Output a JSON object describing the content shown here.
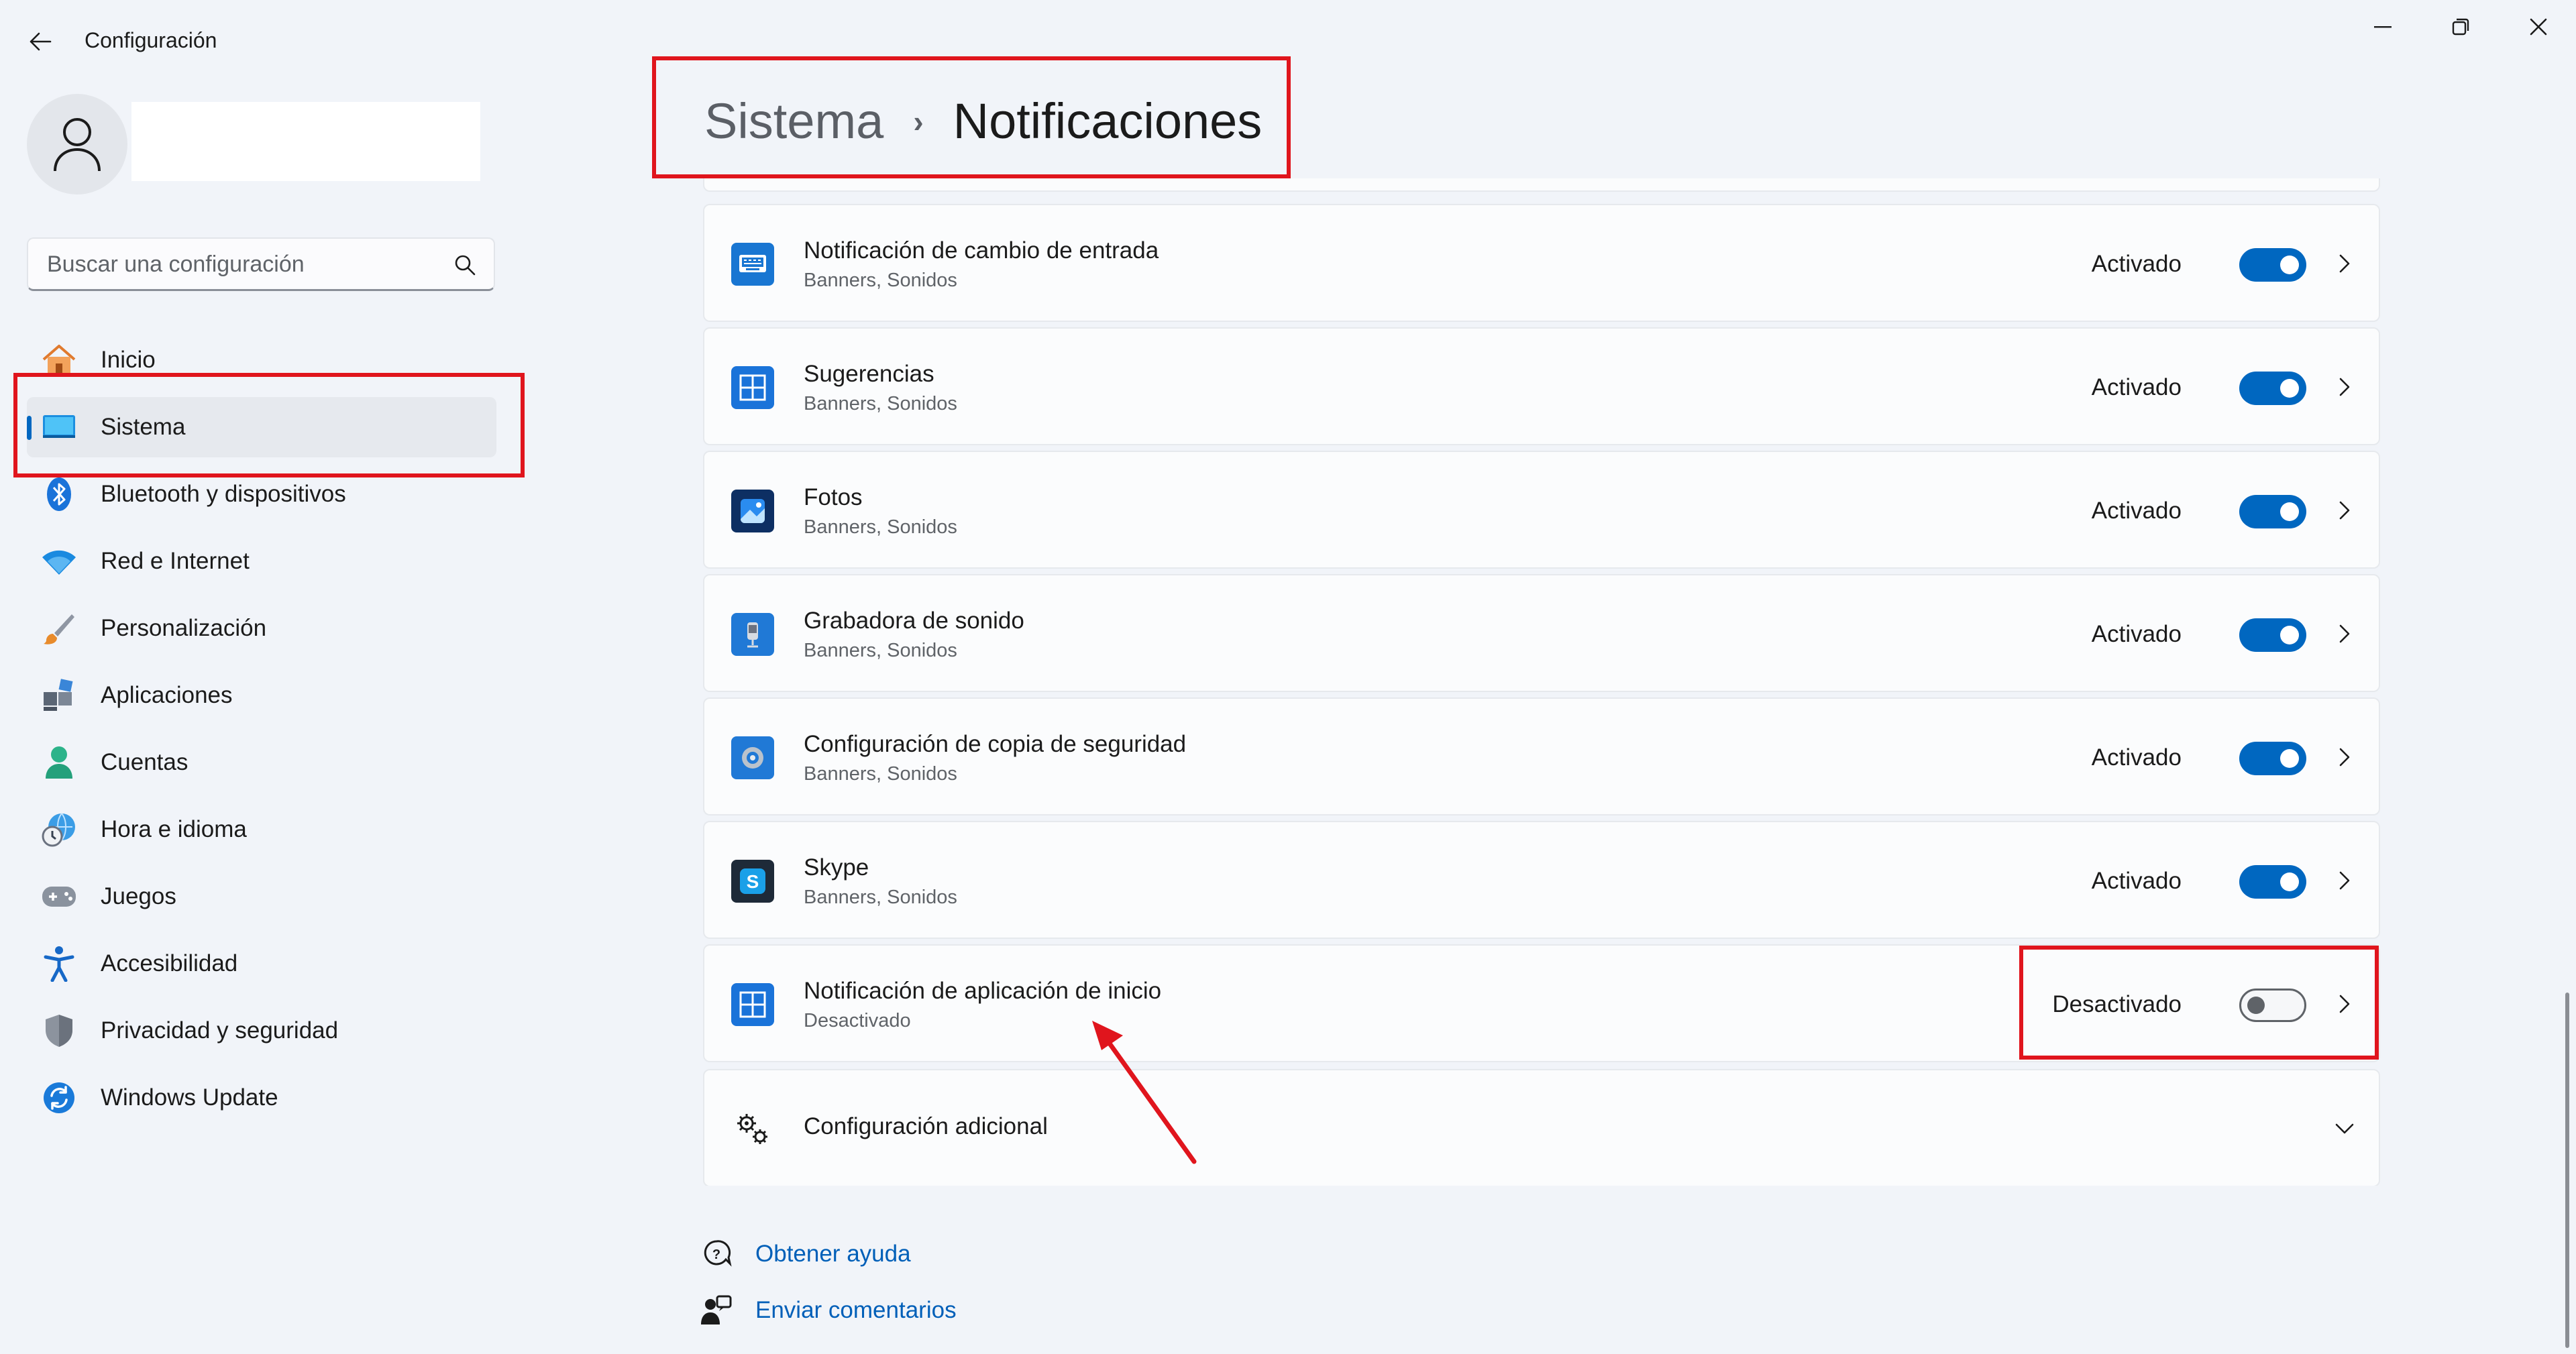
{
  "window": {
    "title": "Configuración"
  },
  "search": {
    "placeholder": "Buscar una configuración"
  },
  "sidebar": {
    "items": [
      {
        "label": "Inicio",
        "icon": "home-icon"
      },
      {
        "label": "Sistema",
        "icon": "system-icon",
        "selected": true
      },
      {
        "label": "Bluetooth y dispositivos",
        "icon": "bluetooth-icon"
      },
      {
        "label": "Red e Internet",
        "icon": "wifi-icon"
      },
      {
        "label": "Personalización",
        "icon": "brush-icon"
      },
      {
        "label": "Aplicaciones",
        "icon": "apps-icon"
      },
      {
        "label": "Cuentas",
        "icon": "account-icon"
      },
      {
        "label": "Hora e idioma",
        "icon": "clock-globe-icon"
      },
      {
        "label": "Juegos",
        "icon": "gamepad-icon"
      },
      {
        "label": "Accesibilidad",
        "icon": "accessibility-icon"
      },
      {
        "label": "Privacidad y seguridad",
        "icon": "shield-icon"
      },
      {
        "label": "Windows Update",
        "icon": "update-icon"
      }
    ]
  },
  "header": {
    "parent": "Sistema",
    "separator": "›",
    "current": "Notificaciones"
  },
  "notifications": [
    {
      "title": "Notificación de cambio de entrada",
      "subtitle": "Banners, Sonidos",
      "state": "Activado",
      "enabled": true,
      "icon": "keyboard-app-icon"
    },
    {
      "title": "Sugerencias",
      "subtitle": "Banners, Sonidos",
      "state": "Activado",
      "enabled": true,
      "icon": "windows-app-icon"
    },
    {
      "title": "Fotos",
      "subtitle": "Banners, Sonidos",
      "state": "Activado",
      "enabled": true,
      "icon": "photos-app-icon"
    },
    {
      "title": "Grabadora de sonido",
      "subtitle": "Banners, Sonidos",
      "state": "Activado",
      "enabled": true,
      "icon": "recorder-app-icon"
    },
    {
      "title": "Configuración de copia de seguridad",
      "subtitle": "Banners, Sonidos",
      "state": "Activado",
      "enabled": true,
      "icon": "backup-app-icon"
    },
    {
      "title": "Skype",
      "subtitle": "Banners, Sonidos",
      "state": "Activado",
      "enabled": true,
      "icon": "skype-app-icon"
    },
    {
      "title": "Notificación de aplicación de inicio",
      "subtitle": "Desactivado",
      "state": "Desactivado",
      "enabled": false,
      "icon": "windows-app-icon"
    }
  ],
  "additional": {
    "label": "Configuración adicional",
    "icon": "gears-icon"
  },
  "footer": {
    "help": "Obtener ayuda",
    "feedback": "Enviar comentarios"
  },
  "colors": {
    "accent": "#0067c0",
    "link": "#005fb8",
    "annotation": "#e0151d",
    "background": "#f1f4f9"
  }
}
